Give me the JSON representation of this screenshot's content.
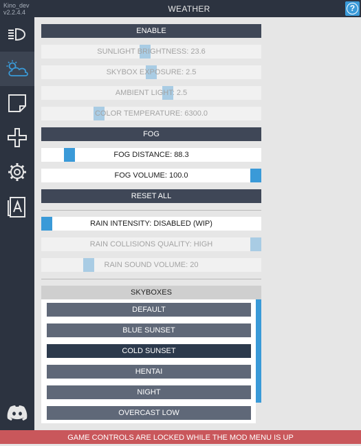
{
  "app": {
    "name": "Kino_dev",
    "version": "v2.2.4.4"
  },
  "header": {
    "title": "WEATHER",
    "help_icon": "help-icon"
  },
  "sidebar": {
    "items": [
      {
        "icon": "headlight-icon",
        "active": false
      },
      {
        "icon": "weather-icon",
        "active": true
      },
      {
        "icon": "note-icon",
        "active": false
      },
      {
        "icon": "plus-icon",
        "active": false
      },
      {
        "icon": "gear-icon",
        "active": false
      },
      {
        "icon": "font-icon",
        "active": false
      },
      {
        "icon": "discord-icon",
        "active": false
      }
    ]
  },
  "weather": {
    "enable_label": "ENABLE",
    "sunlight": {
      "label": "SUNLIGHT BRIGHTNESS: 23.6",
      "value": 23.6,
      "position": 0.47
    },
    "skybox_exposure": {
      "label": "SKYBOX EXPOSURE: 2.5",
      "value": 2.5,
      "position": 0.5
    },
    "ambient_light": {
      "label": "AMBIENT LIGHT: 2.5",
      "value": 2.5,
      "position": 0.58
    },
    "color_temperature": {
      "label": "COLOR TEMPERATURE: 6300.0",
      "value": 6300.0,
      "position": 0.25
    },
    "fog_header": "FOG",
    "fog_distance": {
      "label": "FOG DISTANCE: 88.3",
      "value": 88.3,
      "position": 0.11
    },
    "fog_volume": {
      "label": "FOG VOLUME: 100.0",
      "value": 100.0,
      "position": 1.0
    },
    "reset_label": "RESET ALL",
    "rain_intensity": {
      "label": "RAIN INTENSITY: DISABLED (WIP)",
      "position": 0.0
    },
    "rain_collisions": {
      "label": "RAIN COLLISIONS QUALITY: HIGH",
      "position": 1.0
    },
    "rain_sound": {
      "label": "RAIN SOUND VOLUME: 20",
      "value": 20,
      "position": 0.2
    }
  },
  "skyboxes": {
    "title": "SKYBOXES",
    "items": [
      {
        "label": "DEFAULT",
        "selected": false
      },
      {
        "label": "BLUE SUNSET",
        "selected": false
      },
      {
        "label": "COLD SUNSET",
        "selected": true
      },
      {
        "label": "HENTAI",
        "selected": false
      },
      {
        "label": "NIGHT",
        "selected": false
      },
      {
        "label": "OVERCAST LOW",
        "selected": false
      }
    ]
  },
  "footer": {
    "message": "GAME CONTROLS ARE LOCKED WHILE THE MOD MENU IS UP"
  },
  "colors": {
    "accent": "#3a9ad8",
    "dark": "#2c3340",
    "button": "#3f4757",
    "skybox_item": "#5f6878",
    "skybox_selected": "#2c3a4d",
    "footer": "#c9575b"
  }
}
